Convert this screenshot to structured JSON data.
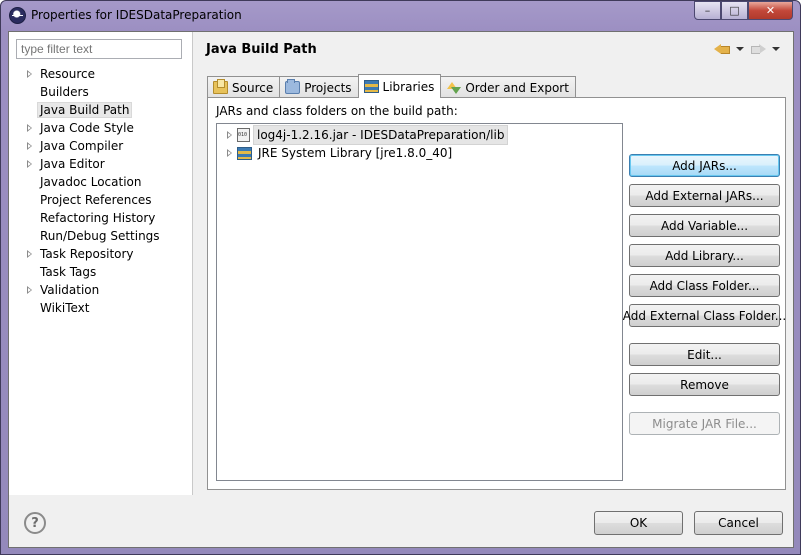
{
  "window": {
    "title": "Properties for IDESDataPreparation",
    "minimize": "–",
    "maximize": "□",
    "close": "✕"
  },
  "filter": {
    "placeholder": "type filter text"
  },
  "nav_tree": [
    {
      "label": "Resource",
      "expandable": true
    },
    {
      "label": "Builders",
      "expandable": false
    },
    {
      "label": "Java Build Path",
      "expandable": false,
      "selected": true
    },
    {
      "label": "Java Code Style",
      "expandable": true
    },
    {
      "label": "Java Compiler",
      "expandable": true
    },
    {
      "label": "Java Editor",
      "expandable": true
    },
    {
      "label": "Javadoc Location",
      "expandable": false
    },
    {
      "label": "Project References",
      "expandable": false
    },
    {
      "label": "Refactoring History",
      "expandable": false
    },
    {
      "label": "Run/Debug Settings",
      "expandable": false
    },
    {
      "label": "Task Repository",
      "expandable": true
    },
    {
      "label": "Task Tags",
      "expandable": false
    },
    {
      "label": "Validation",
      "expandable": true
    },
    {
      "label": "WikiText",
      "expandable": false
    }
  ],
  "page": {
    "title": "Java Build Path"
  },
  "tabs": [
    {
      "label": "Source",
      "icon": "source-folder-icon"
    },
    {
      "label": "Projects",
      "icon": "projects-folder-icon"
    },
    {
      "label": "Libraries",
      "icon": "libraries-icon",
      "active": true
    },
    {
      "label": "Order and Export",
      "icon": "order-export-icon"
    }
  ],
  "libraries": {
    "heading": "JARs and class folders on the build path:",
    "entries": [
      {
        "label": "log4j-1.2.16.jar - IDESDataPreparation/lib",
        "icon": "jar-icon",
        "selected": true
      },
      {
        "label": "JRE System Library [jre1.8.0_40]",
        "icon": "library-icon"
      }
    ],
    "buttons": {
      "add_jars": "Add JARs...",
      "add_external_jars": "Add External JARs...",
      "add_variable": "Add Variable...",
      "add_library": "Add Library...",
      "add_class_folder": "Add Class Folder...",
      "add_external_class_folder": "Add External Class Folder...",
      "edit": "Edit...",
      "remove": "Remove",
      "migrate_jar": "Migrate JAR File..."
    }
  },
  "footer": {
    "help": "?",
    "ok": "OK",
    "cancel": "Cancel"
  }
}
